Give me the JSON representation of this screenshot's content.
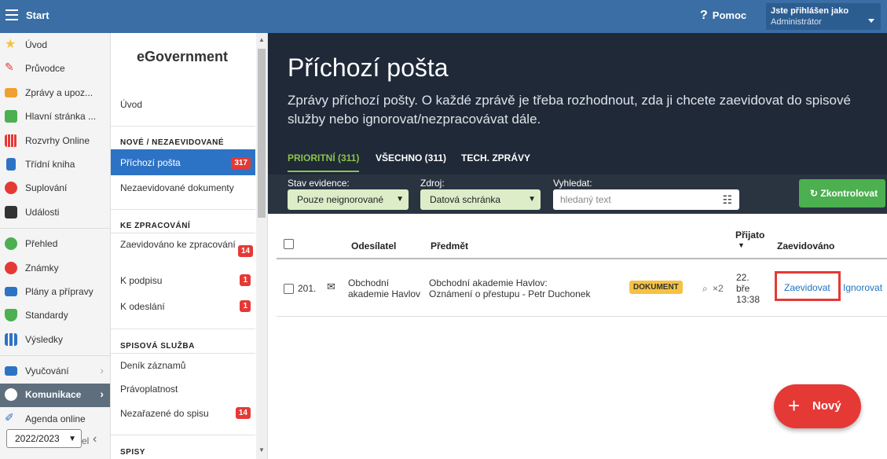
{
  "topbar": {
    "start_label": "Start",
    "help_label": "Pomoc",
    "user_line1": "Jste přihlášen jako",
    "user_line2": "Administrátor"
  },
  "leftnav": {
    "items": [
      {
        "label": "Úvod",
        "icon": "star-icon",
        "color": "#f5c242"
      },
      {
        "label": "Průvodce",
        "icon": "wand-icon",
        "color": "#e53935"
      },
      {
        "label": "Zprávy a upoz...",
        "icon": "envelope-icon",
        "color": "#f0a030"
      },
      {
        "label": "Hlavní stránka ...",
        "icon": "home-icon",
        "color": "#4caf50"
      },
      {
        "label": "Rozvrhy Online",
        "icon": "calendar-grid-icon",
        "color": "#e53935"
      },
      {
        "label": "Třídní kniha",
        "icon": "book-icon",
        "color": "#2d73c5"
      },
      {
        "label": "Suplování",
        "icon": "person-icon",
        "color": "#e53935"
      },
      {
        "label": "Události",
        "icon": "calendar-icon",
        "color": "#333333"
      },
      {
        "label": "Přehled",
        "icon": "check-circle-icon",
        "color": "#4caf50"
      },
      {
        "label": "Známky",
        "icon": "grade-icon",
        "color": "#e53935"
      },
      {
        "label": "Plány a přípravy",
        "icon": "briefcase-icon",
        "color": "#2d73c5"
      },
      {
        "label": "Standardy",
        "icon": "shield-icon",
        "color": "#4caf50"
      },
      {
        "label": "Výsledky",
        "icon": "bar-chart-icon",
        "color": "#2d73c5"
      },
      {
        "label": "Vyučování",
        "icon": "open-book-icon",
        "color": "#2d73c5"
      },
      {
        "label": "Komunikace",
        "icon": "chat-icon",
        "color": "#ffffff"
      },
      {
        "label": "Agenda online",
        "icon": "pen-icon",
        "color": "#2d73c5"
      }
    ],
    "year": "2022/2023",
    "year_tail": "el"
  },
  "subnav": {
    "title": "eGovernment",
    "home": "Úvod",
    "sec1": "NOVÉ / NEZAEVIDOVANÉ",
    "incoming": "Příchozí pošta",
    "incoming_count": "317",
    "unregistered": "Nezaevidované dokumenty",
    "sec2": "KE ZPRACOVÁNÍ",
    "registered": "Zaevidováno ke zpracování",
    "registered_count": "14",
    "to_sign": "K podpisu",
    "to_sign_count": "1",
    "to_send": "K odeslání",
    "to_send_count": "1",
    "sec3": "SPISOVÁ SLUŽBA",
    "journal": "Deník záznamů",
    "validity": "Právoplatnost",
    "unfiled": "Nezařazené do spisu",
    "unfiled_count": "14",
    "sec4": "SPISY"
  },
  "hero": {
    "title": "Příchozí pošta",
    "desc": "Zprávy příchozí pošty. O každé zprávě je třeba rozhodnout, zda ji chcete zaevidovat do spisové služby nebo ignorovat/nezpracovávat dále.",
    "tabs": [
      "PRIORITNÍ (311)",
      "VŠECHNO (311)",
      "TECH. ZPRÁVY"
    ]
  },
  "filters": {
    "status_label": "Stav evidence:",
    "status_value": "Pouze neignorované",
    "source_label": "Zdroj:",
    "source_value": "Datová schránka",
    "search_label": "Vyhledat:",
    "search_placeholder": "hledaný text",
    "check_button": "Zkontrolovat"
  },
  "table": {
    "headers": {
      "sender": "Odesílatel",
      "subject": "Předmět",
      "received_1": "Přijato",
      "registered": "Zaevidováno"
    },
    "rows": [
      {
        "id": "201.",
        "sender_1": "Obchodní",
        "sender_2": "akademie Havlov",
        "subject_1": "Obchodní akademie Havlov:",
        "subject_2": "Oznámení o přestupu - Petr Duchonek",
        "type": "DOKUMENT",
        "attachments": "×2",
        "date_1": "22.",
        "date_2": "bře",
        "date_3": "13:38",
        "action_register": "Zaevidovat",
        "action_ignore": "Ignorovat"
      }
    ]
  },
  "fab": {
    "label": "Nový"
  }
}
